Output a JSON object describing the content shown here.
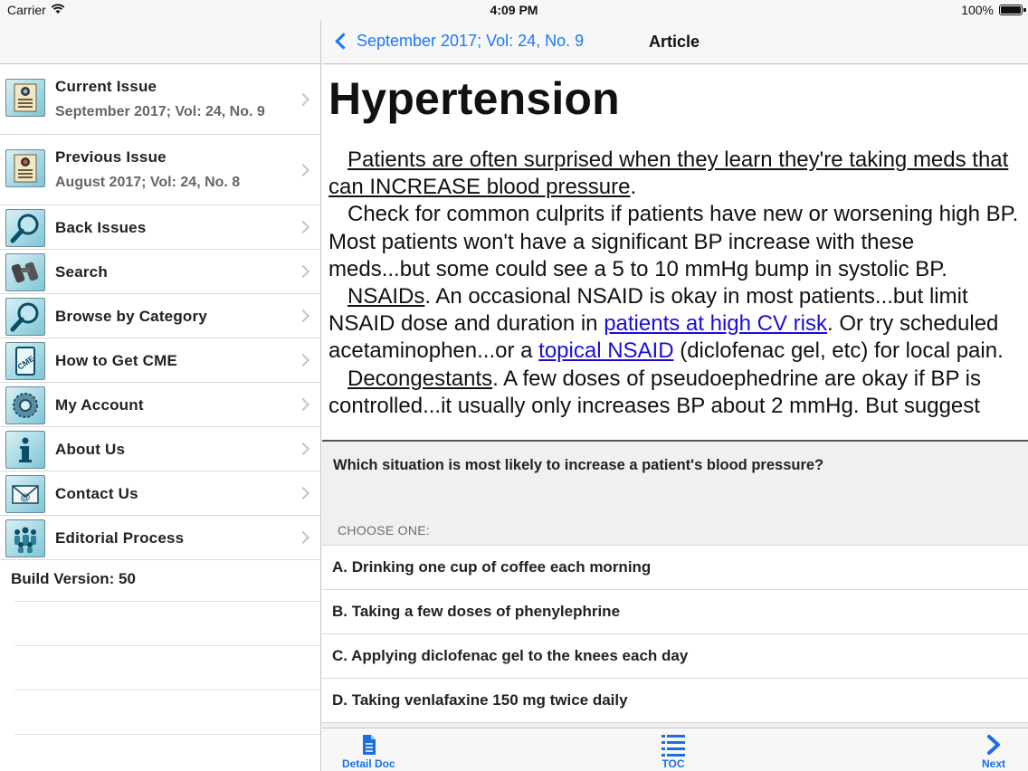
{
  "status_bar": {
    "carrier": "Carrier",
    "time": "4:09 PM",
    "battery": "100%"
  },
  "sidebar": {
    "items": [
      {
        "title": "Current Issue",
        "subtitle": "September 2017; Vol: 24, No. 9",
        "icon": "journal-icon"
      },
      {
        "title": "Previous Issue",
        "subtitle": "August 2017; Vol: 24, No. 8",
        "icon": "journal-icon"
      },
      {
        "title": "Back Issues",
        "icon": "magnifier-icon"
      },
      {
        "title": "Search",
        "icon": "binoculars-icon"
      },
      {
        "title": "Browse by Category",
        "icon": "magnifier-icon"
      },
      {
        "title": "How to Get CME",
        "icon": "cme-icon"
      },
      {
        "title": "My Account",
        "icon": "gear-icon"
      },
      {
        "title": "About Us",
        "icon": "info-icon"
      },
      {
        "title": "Contact Us",
        "icon": "email-icon"
      },
      {
        "title": "Editorial Process",
        "icon": "people-icon"
      }
    ],
    "build_version": "Build Version: 50"
  },
  "nav": {
    "back_label": "September 2017; Vol: 24, No. 9",
    "title": "Article"
  },
  "article": {
    "heading": "Hypertension",
    "p1": "Patients are often surprised when they learn they're taking meds that can INCREASE blood pressure",
    "p1_end": ".",
    "p2": "Check for common culprits if patients have new or worsening high BP. Most patients won't have a significant BP increase with these meds...but some could see a 5 to 10 mmHg bump in systolic BP.",
    "p3_head": "NSAIDs",
    "p3_a": ". An occasional NSAID is okay in most patients...but limit NSAID dose and duration in ",
    "p3_link1": "patients at high CV risk",
    "p3_b": ". Or try scheduled acetaminophen...or a ",
    "p3_link2": "topical NSAID",
    "p3_c": " (diclofenac gel, etc) for local pain.",
    "p4_head": "Decongestants",
    "p4_a": ". A few doses of pseudoephedrine are okay if BP is controlled...it usually only increases BP about 2 mmHg. But suggest"
  },
  "quiz": {
    "question": "Which situation is most likely to increase a patient's blood pressure?",
    "choose_label": "CHOOSE ONE:",
    "answers": [
      "A.  Drinking one cup of coffee each morning",
      "B.  Taking a few doses of phenylephrine",
      "C.  Applying diclofenac gel to the knees each day",
      "D.  Taking venlafaxine 150 mg twice daily"
    ]
  },
  "toolbar": {
    "detail_doc": "Detail Doc",
    "toc": "TOC",
    "next": "Next"
  },
  "colors": {
    "accent": "#1a78ff",
    "link": "#1a0dd8",
    "icon_bg": "#7ec5d6"
  }
}
